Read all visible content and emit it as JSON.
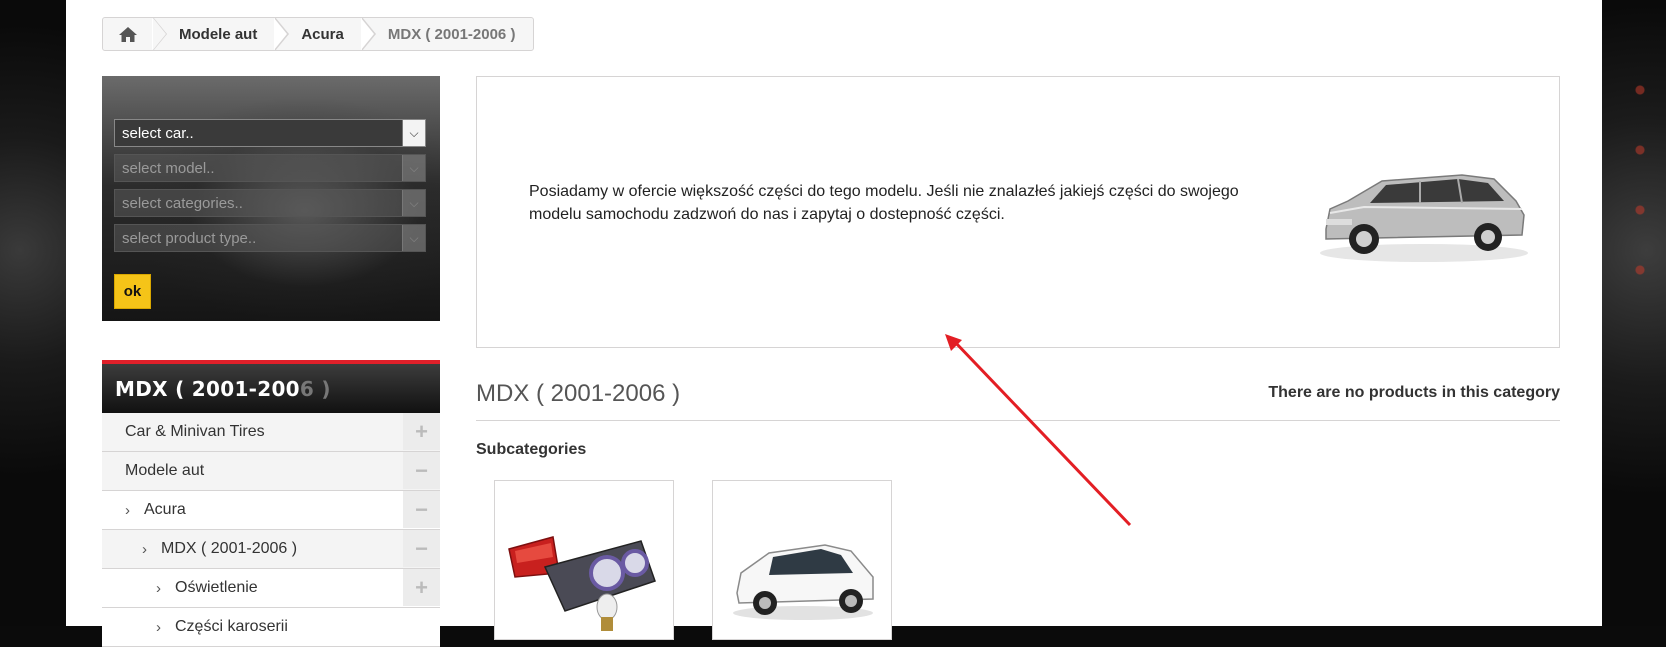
{
  "breadcrumb": {
    "home_icon": "home-icon",
    "items": [
      "Modele aut",
      "Acura"
    ],
    "current": "MDX ( 2001-2006 )"
  },
  "selector": {
    "car": "select car..",
    "model": "select model..",
    "categories": "select categories..",
    "product_type": "select product type..",
    "ok_label": "ok"
  },
  "category_block": {
    "title_main": "MDX ( 2001-200",
    "title_dim": "6 )",
    "items": [
      {
        "label": "Car & Minivan Tires",
        "toggle": "+"
      },
      {
        "label": "Modele aut",
        "toggle": "−"
      },
      {
        "label": "Acura",
        "toggle": "−"
      },
      {
        "label": "MDX ( 2001-2006 )",
        "toggle": "−"
      },
      {
        "label": "Oświetlenie",
        "toggle": "+"
      },
      {
        "label": "Części karoserii",
        "toggle": ""
      }
    ]
  },
  "content": {
    "description": "Posiadamy w ofercie większość części do tego modelu. Jeśli nie znalazłeś jakiejś części do swojego modelu samochodu zadzwoń do nas i zapytaj o dostepność części."
  },
  "main": {
    "heading": "MDX ( 2001-2006 )",
    "no_products": "There are no products in this category",
    "subcategories_title": "Subcategories"
  },
  "colors": {
    "accent_red": "#e0202a",
    "ok_yellow": "#f5c418",
    "annotation_arrow": "#e31e24"
  }
}
